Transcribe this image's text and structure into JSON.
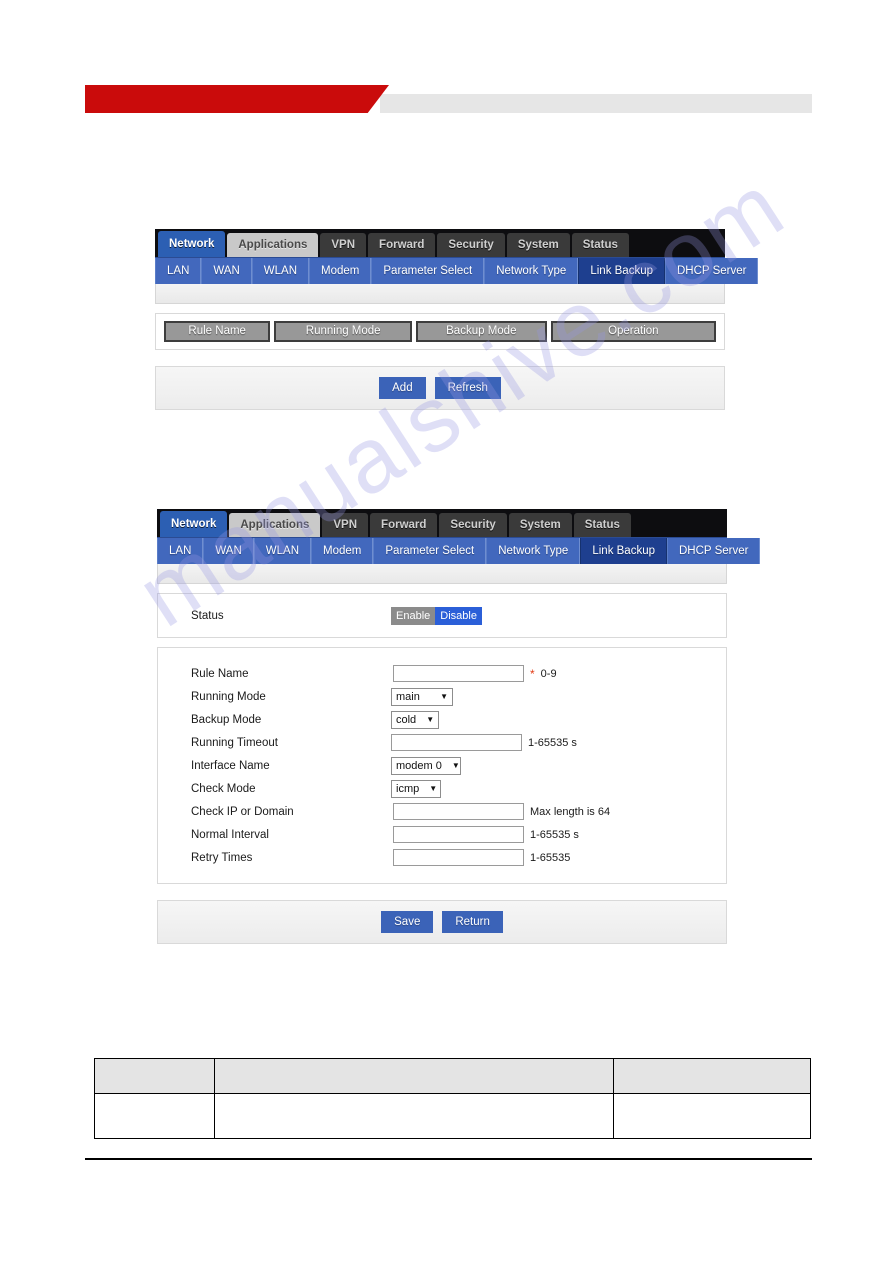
{
  "header": {
    "banner_red_color": "#ca0b0b",
    "banner_gray_color": "#e6e6e6"
  },
  "watermark": {
    "text": "manualshive.com",
    "color": "#9696e1"
  },
  "main_tabs": [
    {
      "label": "Network",
      "state": "active"
    },
    {
      "label": "Applications",
      "state": "hover"
    },
    {
      "label": "VPN",
      "state": "normal"
    },
    {
      "label": "Forward",
      "state": "normal"
    },
    {
      "label": "Security",
      "state": "normal"
    },
    {
      "label": "System",
      "state": "normal"
    },
    {
      "label": "Status",
      "state": "normal"
    }
  ],
  "sub_tabs": [
    {
      "label": "LAN",
      "state": "normal"
    },
    {
      "label": "WAN",
      "state": "normal"
    },
    {
      "label": "WLAN",
      "state": "normal"
    },
    {
      "label": "Modem",
      "state": "normal"
    },
    {
      "label": "Parameter Select",
      "state": "normal"
    },
    {
      "label": "Network Type",
      "state": "normal"
    },
    {
      "label": "Link Backup",
      "state": "active"
    },
    {
      "label": "DHCP Server",
      "state": "normal"
    }
  ],
  "list_panel": {
    "columns": [
      "Rule Name",
      "Running Mode",
      "Backup Mode",
      "Operation"
    ],
    "rows": [],
    "buttons": {
      "add": "Add",
      "refresh": "Refresh"
    }
  },
  "edit_panel": {
    "status": {
      "label": "Status",
      "enable_label": "Enable",
      "disable_label": "Disable",
      "selected": "Disable"
    },
    "fields": [
      {
        "label": "Rule Name",
        "type": "text",
        "value": "",
        "placeholder": "",
        "required": true,
        "hint": "0-9"
      },
      {
        "label": "Running Mode",
        "type": "select",
        "value": "main",
        "hint": ""
      },
      {
        "label": "Backup Mode",
        "type": "select",
        "value": "cold",
        "hint": ""
      },
      {
        "label": "Running Timeout",
        "type": "text",
        "value": "",
        "placeholder": "",
        "required": false,
        "hint": "1-65535 s"
      },
      {
        "label": "Interface Name",
        "type": "select",
        "value": "modem 0",
        "hint": ""
      },
      {
        "label": "Check Mode",
        "type": "select",
        "value": "icmp",
        "hint": ""
      },
      {
        "label": "Check IP or Domain",
        "type": "text",
        "value": "",
        "placeholder": "",
        "required": false,
        "hint": "Max length is 64"
      },
      {
        "label": "Normal Interval",
        "type": "text",
        "value": "",
        "placeholder": "",
        "required": false,
        "hint": "1-65535 s"
      },
      {
        "label": "Retry Times",
        "type": "text",
        "value": "",
        "placeholder": "",
        "required": false,
        "hint": "1-65535"
      }
    ],
    "buttons": {
      "save": "Save",
      "return": "Return"
    }
  },
  "doc_table": {
    "header": [
      "",
      "",
      ""
    ],
    "rows": [
      [
        "",
        "",
        ""
      ]
    ]
  }
}
